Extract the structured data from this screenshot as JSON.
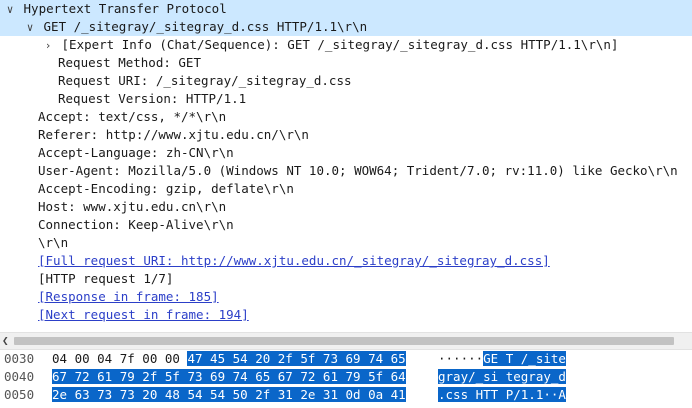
{
  "tree": {
    "protocol": "Hypertext Transfer Protocol",
    "request_line": "GET /_sitegray/_sitegray_d.css HTTP/1.1\\r\\n",
    "expert_info": "[Expert Info (Chat/Sequence): GET /_sitegray/_sitegray_d.css HTTP/1.1\\r\\n]",
    "request_method": "Request Method: GET",
    "request_uri": "Request URI: /_sitegray/_sitegray_d.css",
    "request_version": "Request Version: HTTP/1.1",
    "accept": "Accept: text/css, */*\\r\\n",
    "referer": "Referer: http://www.xjtu.edu.cn/\\r\\n",
    "accept_language": "Accept-Language: zh-CN\\r\\n",
    "user_agent": "User-Agent: Mozilla/5.0 (Windows NT 10.0; WOW64; Trident/7.0; rv:11.0) like Gecko\\r\\n",
    "accept_encoding": "Accept-Encoding: gzip, deflate\\r\\n",
    "host": "Host: www.xjtu.edu.cn\\r\\n",
    "connection": "Connection: Keep-Alive\\r\\n",
    "crlf": "\\r\\n",
    "full_request_uri": "[Full request URI: http://www.xjtu.edu.cn/_sitegray/_sitegray_d.css]",
    "http_request": "[HTTP request 1/7]",
    "response_in_frame": "[Response in frame: 185]",
    "next_request_in_frame": "[Next request in frame: 194]"
  },
  "icons": {
    "expanded": "chevron-down-icon",
    "collapsed": "chevron-right-icon",
    "scroll_left": "scroll-left-icon"
  },
  "hex": {
    "rows": [
      {
        "offset": "0030",
        "bytes_plain": "04 00 04 7f 00 00 ",
        "bytes_hl": "47 45  54 20 2f 5f 73 69 74 65",
        "ascii_plain": "······",
        "ascii_hl": "GE T /_site"
      },
      {
        "offset": "0040",
        "bytes_plain": "",
        "bytes_hl": "67 72 61 79 2f 5f 73 69  74 65 67 72 61 79 5f 64",
        "ascii_plain": "",
        "ascii_hl": "gray/_si tegray_d"
      },
      {
        "offset": "0050",
        "bytes_plain": "",
        "bytes_hl": "2e 63 73 73 20 48 54 54  50 2f 31 2e 31 0d 0a 41",
        "ascii_plain": "",
        "ascii_hl": ".css HTT P/1.1··A"
      }
    ]
  },
  "colors": {
    "selection_bg": "#cce8ff",
    "hex_highlight": "#0a66c9",
    "link": "#2c3fc8"
  }
}
